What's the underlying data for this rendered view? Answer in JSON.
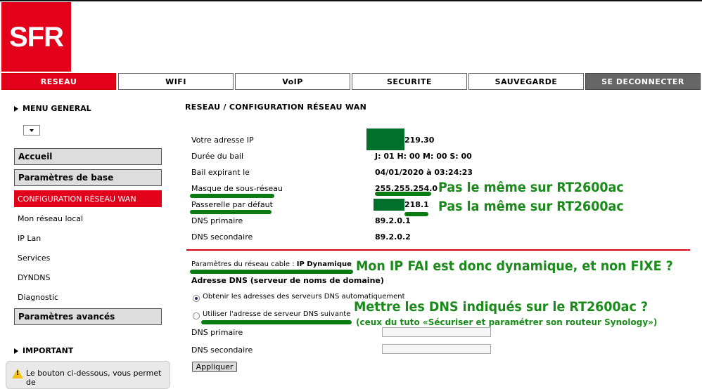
{
  "logo": "SFR",
  "nav": {
    "tabs": [
      "RESEAU",
      "WIFI",
      "VoIP",
      "SECURITE",
      "SAUVEGARDE",
      "SE DECONNECTER"
    ]
  },
  "sidebar": {
    "menu_general": "MENU GENERAL",
    "items": [
      {
        "label": "Accueil",
        "type": "category"
      },
      {
        "label": "Paramètres de base",
        "type": "category"
      },
      {
        "label": "CONFIGURATION RÉSEAU WAN",
        "type": "selected"
      },
      {
        "label": "Mon réseau local",
        "type": "item"
      },
      {
        "label": "IP Lan",
        "type": "item"
      },
      {
        "label": "Services",
        "type": "item"
      },
      {
        "label": "DYNDNS",
        "type": "item"
      },
      {
        "label": "Diagnostic",
        "type": "item"
      },
      {
        "label": "Paramètres avancés",
        "type": "category"
      }
    ],
    "important": "IMPORTANT",
    "warning_text": "Le bouton ci-dessous, vous permet de"
  },
  "main": {
    "title": "RESEAU / CONFIGURATION RÉSEAU WAN",
    "info_rows": [
      {
        "label": "Votre adresse IP",
        "value": "219.30"
      },
      {
        "label": "Durée du bail",
        "value": "J: 01 H: 00 M: 00 S: 00"
      },
      {
        "label": "Bail expirant le",
        "value": "04/01/2020 à 03:24:23"
      },
      {
        "label": "Masque de sous-réseau",
        "value": "255.255.254.0"
      },
      {
        "label": "Passerelle par défaut",
        "value": "218.1"
      },
      {
        "label": "DNS primaire",
        "value": "89.2.0.1"
      },
      {
        "label": "DNS secondaire",
        "value": "89.2.0.2"
      }
    ],
    "cable_params_label": "Paramètres du réseau cable :",
    "cable_params_value": "IP Dynamique",
    "dns_section_title": "Adresse DNS (serveur de noms de domaine)",
    "radio_auto": "Obtenir les adresses des serveurs DNS automatiquement",
    "radio_manual": "Utiliser l'adresse de serveur DNS suivante",
    "dns_primary_label": "DNS primaire",
    "dns_secondary_label": "DNS secondaire",
    "apply_button": "Appliquer"
  },
  "annotations": {
    "mask_note": "Pas le même sur RT2600ac",
    "gateway_note": "Pas la même sur RT2600ac",
    "ip_note": "Mon IP FAI est donc dynamique, et non FIXE ?",
    "dns_note": "Mettre les DNS indiqués sur le RT2600ac ?",
    "dns_subnote": "(ceux du tuto «Sécuriser et paramétrer son routeur Synology»)"
  },
  "colors": {
    "brand_red": "#e2001a",
    "annotation_green": "#1a8a1a"
  }
}
